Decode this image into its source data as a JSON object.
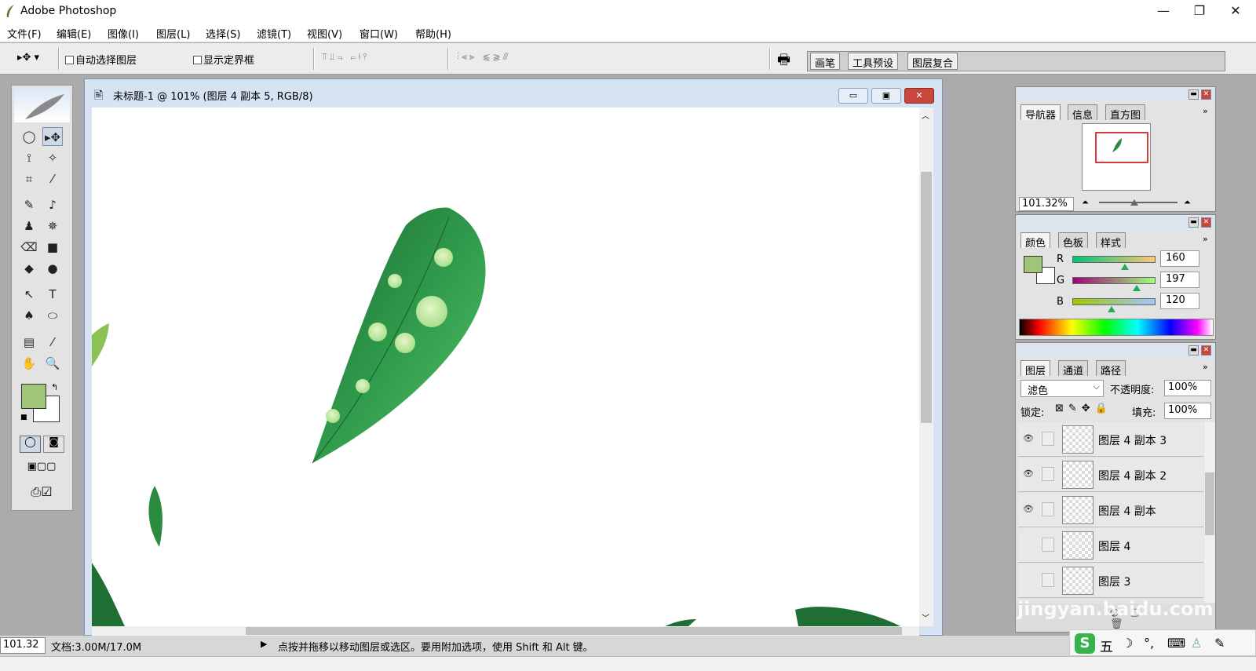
{
  "window": {
    "title": "Adobe Photoshop",
    "minimize": "—",
    "restore": "❐",
    "close": "✕"
  },
  "menu": [
    "文件(F)",
    "编辑(E)",
    "图像(I)",
    "图层(L)",
    "选择(S)",
    "滤镜(T)",
    "视图(V)",
    "窗口(W)",
    "帮助(H)"
  ],
  "options": {
    "tool_icon": "▸✥ ▾",
    "auto_select": "自动选择图层",
    "show_bounds": "显示定界框",
    "align1": "⫪⫫⫬ ⫭⫮⫯",
    "align2": "⫶⫷⫸ ⫹⫺⫻",
    "well_tabs": [
      "画笔",
      "工具预设",
      "图层复合"
    ]
  },
  "toolbox": {
    "tools": [
      "◯",
      "▸✥",
      "⟟",
      "✧",
      "⌗",
      "⁄",
      "✎",
      "♪",
      "♟",
      "✵",
      "⌫",
      "■",
      "◆",
      "●",
      "↖",
      "T",
      "♠",
      "⬭",
      "▤",
      "⁄",
      "✋",
      "🔍"
    ],
    "fg_color": "#a0c578",
    "bg_color": "#ffffff"
  },
  "document": {
    "title": "未标题-1 @ 101% (图层 4 副本 5, RGB/8)"
  },
  "navigator": {
    "tabs": [
      "导航器",
      "信息",
      "直方图"
    ],
    "zoom": "101.32%"
  },
  "color": {
    "tabs": [
      "颜色",
      "色板",
      "样式"
    ],
    "channels": [
      {
        "label": "R",
        "value": "160",
        "fraction": 0.63
      },
      {
        "label": "G",
        "value": "197",
        "fraction": 0.77
      },
      {
        "label": "B",
        "value": "120",
        "fraction": 0.47
      }
    ],
    "fg": "#a0c578"
  },
  "layers": {
    "tabs": [
      "图层",
      "通道",
      "路径"
    ],
    "blend_mode": "滤色",
    "opacity_label": "不透明度:",
    "opacity": "100%",
    "lock_label": "锁定:",
    "fill_label": "填充:",
    "fill": "100%",
    "items": [
      {
        "name": "图层 4 副本 3",
        "visible": true
      },
      {
        "name": "图层 4 副本 2",
        "visible": true
      },
      {
        "name": "图层 4 副本",
        "visible": true
      },
      {
        "name": "图层 4",
        "visible": false
      },
      {
        "name": "图层 3",
        "visible": false
      }
    ]
  },
  "status": {
    "zoom": "101.32",
    "doc_size": "文档:3.00M/17.0M",
    "hint": "点按并拖移以移动图层或选区。要用附加选项，使用 Shift 和 Alt 键。"
  },
  "ime": {
    "logo": "S",
    "items": [
      "五",
      "☽",
      "°,",
      "⌨",
      "♙",
      "✎"
    ]
  },
  "watermark": "jingyan.baidu.com"
}
